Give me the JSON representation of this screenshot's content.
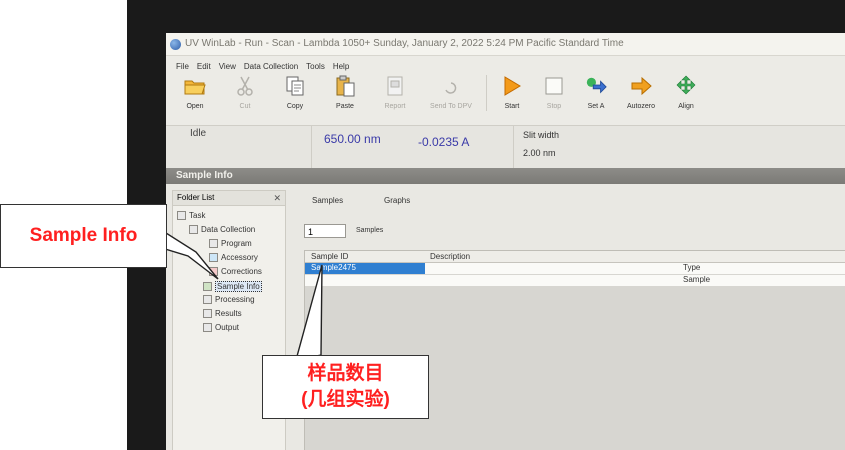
{
  "window": {
    "title": "UV WinLab - Run - Scan - Lambda 1050+ Sunday, January 2, 2022 5:24 PM Pacific Standard Time"
  },
  "menu": [
    "File",
    "Edit",
    "View",
    "Data Collection",
    "Tools",
    "Help"
  ],
  "toolbar": {
    "open": "Open",
    "cut": "Cut",
    "copy": "Copy",
    "paste": "Paste",
    "report": "Report",
    "send_to_dpv": "Send To DPV",
    "start": "Start",
    "stop": "Stop",
    "set_a": "Set A",
    "autozero": "Autozero",
    "align": "Align"
  },
  "status": {
    "state": "Idle",
    "wavelength": "650.00 nm",
    "absorbance": "-0.0235 A",
    "slit_label": "Slit width",
    "slit_value": "2.00 nm"
  },
  "section": {
    "title": "Sample Info"
  },
  "folder_list": {
    "title": "Folder List",
    "close": "✕",
    "task": "Task",
    "data_collection": "Data Collection",
    "program": "Program",
    "accessory": "Accessory",
    "corrections": "Corrections",
    "sample_info": "Sample Info",
    "processing": "Processing",
    "results": "Results",
    "output": "Output"
  },
  "tabs": {
    "samples": "Samples",
    "graphs": "Graphs"
  },
  "samples": {
    "count": "1",
    "label": "Samples"
  },
  "grid": {
    "col_sample_id": "Sample ID",
    "col_description": "Description",
    "col_type": "Type",
    "row1_sample_id": "Sample2475",
    "row1_type": "Sample"
  },
  "annotations": {
    "sample_info": "Sample Info",
    "sample_count_line1": "样品数目",
    "sample_count_line2": "(几组实验)",
    "text_color": "#ff2020"
  },
  "colors": {
    "start_icon": "#f39a1a",
    "selection": "#2f7fd1",
    "status_blue": "#3a3aa8"
  }
}
